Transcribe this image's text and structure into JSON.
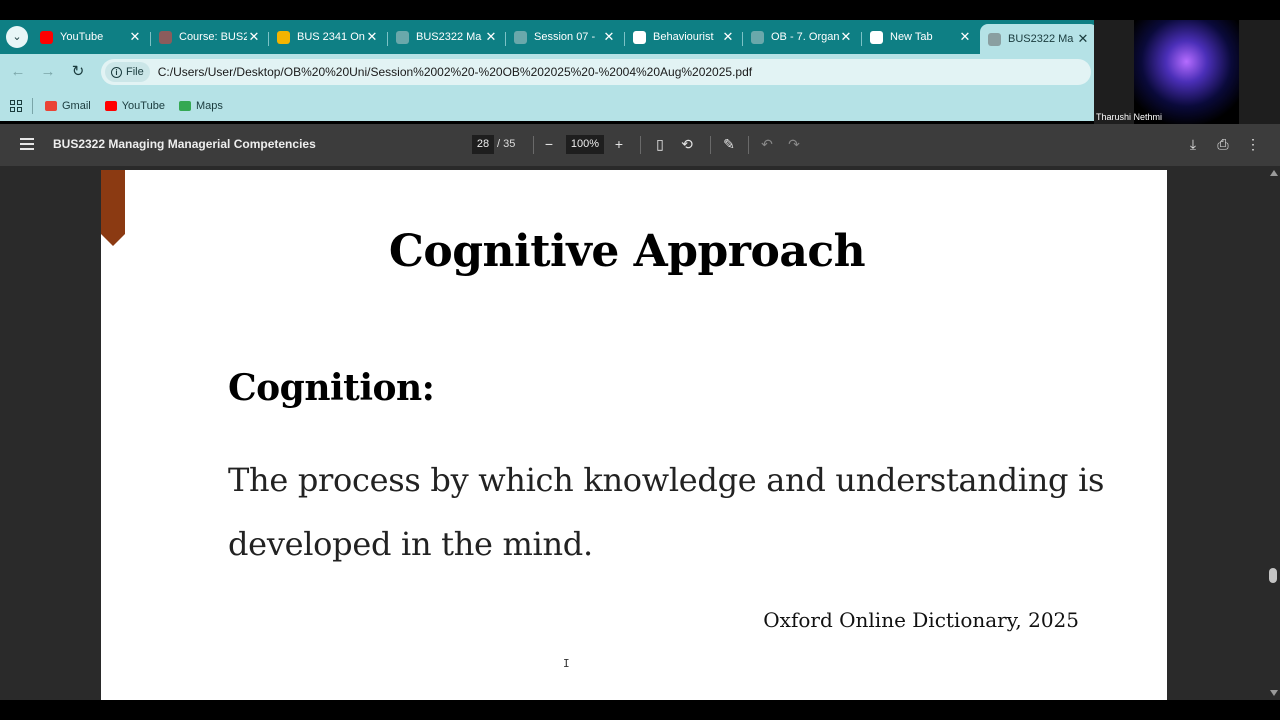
{
  "tabs": [
    {
      "title": "YouTube",
      "icon": "youtube-icon",
      "color": "#ff0000"
    },
    {
      "title": "Course: BUS2",
      "icon": "course-icon",
      "color": "#8b5c5c"
    },
    {
      "title": "BUS 2341 On",
      "icon": "drive-icon",
      "color": "#f4b400"
    },
    {
      "title": "BUS2322 Ma",
      "icon": "globe-icon",
      "color": "#6aa8ab"
    },
    {
      "title": "Session 07 -",
      "icon": "globe-icon",
      "color": "#6aa8ab"
    },
    {
      "title": "Behaviourist",
      "icon": "chatgpt-icon",
      "color": "#ffffff"
    },
    {
      "title": "OB - 7. Organ",
      "icon": "globe-icon",
      "color": "#6aa8ab"
    },
    {
      "title": "New Tab",
      "icon": "chrome-icon",
      "color": "#ffffff"
    },
    {
      "title": "BUS2322 Ma",
      "icon": "globe-icon",
      "color": "#8a9fa1"
    }
  ],
  "address_bar": {
    "chip_label": "File",
    "url": "C:/Users/User/Desktop/OB%20%20Uni/Session%2002%20-%20OB%202025%20-%2004%20Aug%202025.pdf"
  },
  "bookmarks": [
    {
      "label": "Gmail",
      "icon": "gmail-icon",
      "color": "#ea4335"
    },
    {
      "label": "YouTube",
      "icon": "youtube-icon",
      "color": "#ff0000"
    },
    {
      "label": "Maps",
      "icon": "maps-icon",
      "color": "#34a853"
    }
  ],
  "video": {
    "participant": "Tharushi Nethmi"
  },
  "pdf_toolbar": {
    "title": "BUS2322 Managing Managerial Competencies",
    "page_current": "28",
    "page_total": "/ 35",
    "zoom": "100%"
  },
  "slide": {
    "title": "Cognitive Approach",
    "term": "Cognition:",
    "definition": "The process by which knowledge and understanding is developed in the mind.",
    "source": "Oxford Online Dictionary, 2025"
  },
  "colors": {
    "tabbar": "#0e7f84",
    "chrome": "#b5e2e6",
    "ribbon": "#8b3a12",
    "pdf_toolbar": "#3c3c3c"
  }
}
